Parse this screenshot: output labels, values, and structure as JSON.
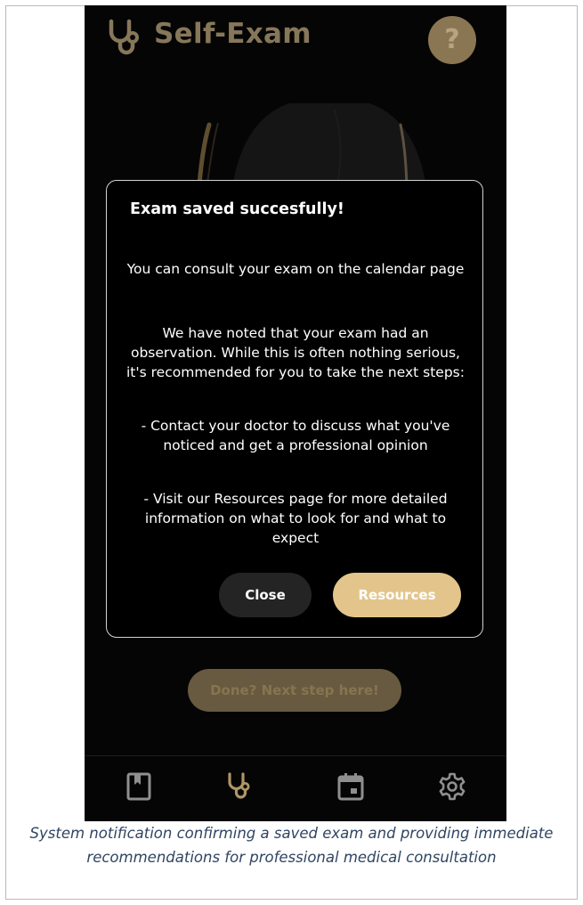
{
  "app": {
    "title": "Self-Exam",
    "help_label": "?",
    "brand_icon": "stethoscope-icon",
    "accent_color": "#e3c58c"
  },
  "dialog": {
    "title": "Exam saved succesfully!",
    "paragraphs": [
      "You can consult your exam on the calendar page",
      "We have noted that your exam had an observation. While this is often nothing serious, it's recommended for you to take the next steps:",
      "- Contact your doctor to discuss what you've noticed and get a professional opinion",
      "- Visit our Resources page for more detailed information on what to look for and what to expect"
    ],
    "close_label": "Close",
    "resources_label": "Resources"
  },
  "main": {
    "next_step_label": "Done? Next step here!"
  },
  "nav": {
    "items": [
      {
        "icon": "book-icon"
      },
      {
        "icon": "stethoscope-icon"
      },
      {
        "icon": "calendar-icon"
      },
      {
        "icon": "gear-icon"
      }
    ]
  },
  "caption": "System notification confirming a saved exam and providing immediate recommendations for professional medical consultation"
}
